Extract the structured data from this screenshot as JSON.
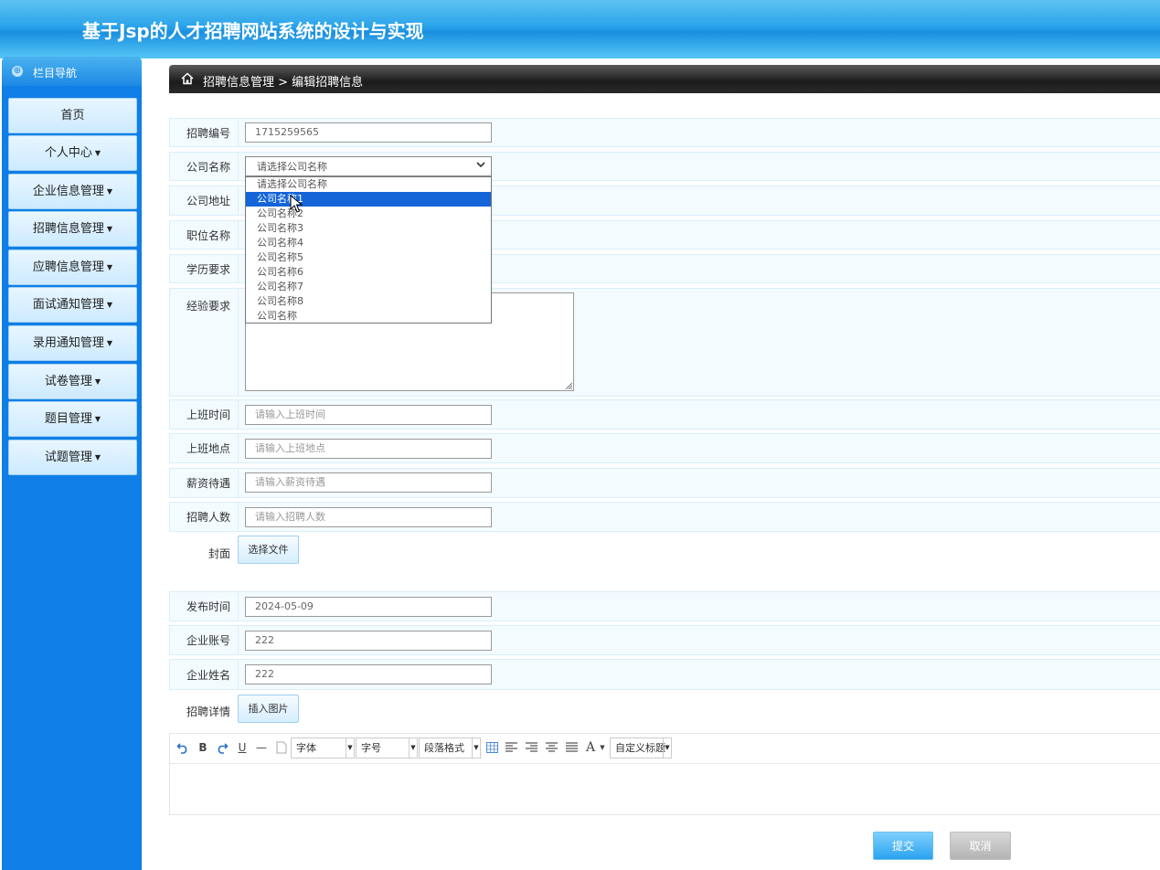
{
  "app_title": "基于Jsp的人才招聘网站系统的设计与实现",
  "sidebar": {
    "heading": "栏目导航",
    "items": [
      {
        "label": "首页",
        "has_caret": false
      },
      {
        "label": "个人中心",
        "has_caret": true
      },
      {
        "label": "企业信息管理",
        "has_caret": true
      },
      {
        "label": "招聘信息管理",
        "has_caret": true
      },
      {
        "label": "应聘信息管理",
        "has_caret": true
      },
      {
        "label": "面试通知管理",
        "has_caret": true
      },
      {
        "label": "录用通知管理",
        "has_caret": true
      },
      {
        "label": "试卷管理",
        "has_caret": true
      },
      {
        "label": "题目管理",
        "has_caret": true
      },
      {
        "label": "试题管理",
        "has_caret": true
      }
    ],
    "caret": "▼"
  },
  "breadcrumb": {
    "text": "招聘信息管理 > 编辑招聘信息"
  },
  "form": {
    "recruit_no": {
      "label": "招聘编号",
      "value": "1715259565"
    },
    "company_name": {
      "label": "公司名称",
      "selected": "请选择公司名称",
      "options": [
        "请选择公司名称",
        "公司名称1",
        "公司名称2",
        "公司名称3",
        "公司名称4",
        "公司名称5",
        "公司名称6",
        "公司名称7",
        "公司名称8",
        "公司名称"
      ],
      "highlighted_option": "公司名称1"
    },
    "company_address": {
      "label": "公司地址"
    },
    "position_name": {
      "label": "职位名称"
    },
    "education": {
      "label": "学历要求"
    },
    "experience": {
      "label": "经验要求"
    },
    "work_time": {
      "label": "上班时间",
      "placeholder": "请输入上班时间"
    },
    "work_place": {
      "label": "上班地点",
      "placeholder": "请输入上班地点"
    },
    "salary": {
      "label": "薪资待遇",
      "placeholder": "请输入薪资待遇"
    },
    "headcount": {
      "label": "招聘人数",
      "placeholder": "请输入招聘人数"
    },
    "cover": {
      "label": "封面",
      "button": "选择文件"
    },
    "publish_time": {
      "label": "发布时间",
      "value": "2024-05-09"
    },
    "company_account": {
      "label": "企业账号",
      "value": "222"
    },
    "company_person": {
      "label": "企业姓名",
      "value": "222"
    },
    "details": {
      "label": "招聘详情",
      "button": "插入图片"
    }
  },
  "editor": {
    "bold": "B",
    "underline": "U",
    "hr": "—",
    "font_family": "字体",
    "font_size": "字号",
    "paragraph": "段落格式",
    "font_color": "A",
    "custom_heading": "自定义标题"
  },
  "actions": {
    "submit": "提交",
    "cancel": "取消"
  },
  "colors": {
    "header_blue": "#2aa3ea",
    "sidebar_blue": "#0f7ee6",
    "selected_option": "#1565d8"
  }
}
